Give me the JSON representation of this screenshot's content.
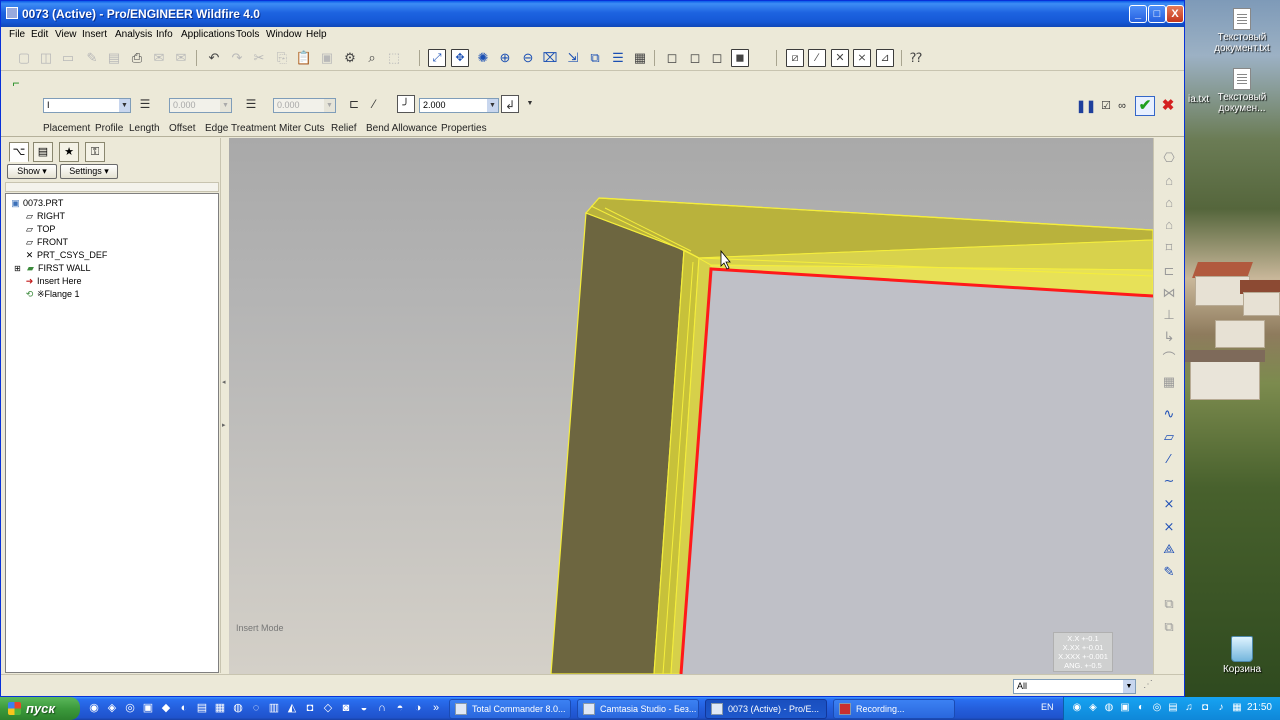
{
  "window": {
    "title": "0073 (Active) - Pro/ENGINEER Wildfire 4.0",
    "controls": {
      "minimize": "_",
      "maximize": "□",
      "close": "X"
    }
  },
  "menu": [
    "File",
    "Edit",
    "View",
    "Insert",
    "Analysis",
    "Info",
    "Applications",
    "Tools",
    "Window",
    "Help"
  ],
  "dashboard": {
    "shape_value": "I",
    "width_value": "0.000",
    "length_value": "0.000",
    "radius_value": "2.000",
    "tabs": [
      "Placement",
      "Profile",
      "Length",
      "Offset",
      "Edge Treatment",
      "Miter Cuts",
      "Relief",
      "Bend Allowance",
      "Properties"
    ]
  },
  "left_panel": {
    "show_label": "Show ▾",
    "settings_label": "Settings ▾",
    "tree": [
      {
        "label": "0073.PRT",
        "icon": "part-icon"
      },
      {
        "label": "RIGHT",
        "icon": "datum-plane-icon"
      },
      {
        "label": "TOP",
        "icon": "datum-plane-icon"
      },
      {
        "label": "FRONT",
        "icon": "datum-plane-icon"
      },
      {
        "label": "PRT_CSYS_DEF",
        "icon": "csys-icon"
      },
      {
        "label": "FIRST WALL",
        "icon": "sheetmetal-wall-icon"
      },
      {
        "label": "Insert Here",
        "icon": "insert-arrow-icon"
      },
      {
        "label": "※Flange 1",
        "icon": "flange-icon"
      }
    ]
  },
  "graphics": {
    "mode_label": "Insert Mode",
    "tolerance": [
      "X.X +-0.1",
      "X.XX +-0.01",
      "X.XXX +-0.001",
      "ANG. +-0.5"
    ]
  },
  "status": {
    "filter_value": "All"
  },
  "desktop": {
    "icons": [
      "Текстовый документ.txt",
      "Текстовый докумен...",
      "Корзина"
    ],
    "partial_label": "ia.txt"
  },
  "taskbar": {
    "start_label": "пуск",
    "tasks": [
      "Total Commander 8.0...",
      "Camtasia Studio - Без...",
      "0073 (Active) - Pro/E...",
      "Recording..."
    ],
    "lang": "EN",
    "clock": "21:50"
  },
  "colors": {
    "titlebar": "#1d63e0",
    "wall_fill": "#c7c13a",
    "wall_edge": "#f5ee3c",
    "selected_edge": "#ff1a1a",
    "confirm_green": "#1fa01f",
    "cancel_red": "#d42020"
  }
}
